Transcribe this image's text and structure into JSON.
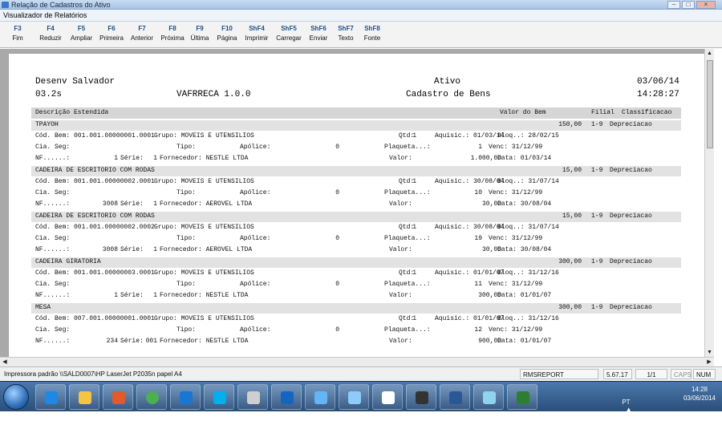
{
  "window": {
    "title": "Relação de Cadastros do Ativo",
    "subtitle": "Visualizador de Relatórios",
    "controls": [
      "–",
      "□",
      "×"
    ]
  },
  "toolbar": [
    {
      "key": "F3",
      "label": "Fim"
    },
    {
      "key": "F4",
      "label": "Reduzir"
    },
    {
      "key": "F5",
      "label": "Ampliar"
    },
    {
      "key": "F6",
      "label": "Primeira"
    },
    {
      "key": "F7",
      "label": "Anterior"
    },
    {
      "key": "F8",
      "label": "Próxima"
    },
    {
      "key": "F9",
      "label": "Última"
    },
    {
      "key": "F10",
      "label": "Página"
    },
    {
      "key": "ShF4",
      "label": "Imprimir"
    },
    {
      "key": "ShF5",
      "label": "Carregar"
    },
    {
      "key": "ShF6",
      "label": "Enviar"
    },
    {
      "key": "ShF7",
      "label": "Texto"
    },
    {
      "key": "ShF8",
      "label": "Fonte"
    }
  ],
  "report": {
    "header": {
      "company": "Desenv Salvador",
      "title": "Ativo",
      "date": "03/06/14",
      "version_code": "03.2s",
      "program": "VAFRRECA 1.0.0",
      "subtitle": "Cadastro de Bens",
      "time": "14:28:27"
    },
    "columns": {
      "description": "Descrição Estendida",
      "value": "Valor do Bem",
      "branch": "Filial",
      "classification": "Classificacao"
    },
    "items": [
      {
        "name": "TPAYOH",
        "value": "150,00",
        "branch": "1-9",
        "classification": "Depreciacao",
        "lines": [
          [
            "Cód. Bem: 001.001.00000001.0001",
            "Grupo: MOVEIS E UTENSILIOS",
            "Qtd:",
            "1",
            "Aquisic.: 01/03/14",
            "Bloq..: 28/02/15"
          ],
          [
            "Cia. Seg:",
            "Tipo:",
            "Apólice:",
            "0",
            "Plaqueta...:",
            "1",
            "Venc: 31/12/99"
          ],
          [
            "NF......:",
            "1",
            "Série:",
            "1",
            "Fornecedor: NESTLE LTDA",
            "Valor:",
            "1.000,00",
            "Data: 01/03/14"
          ]
        ]
      },
      {
        "name": "CADEIRA DE ESCRITORIO COM RODAS",
        "value": "15,00",
        "branch": "1-9",
        "classification": "Depreciacao",
        "lines": [
          [
            "Cód. Bem: 001.001.00000002.0001",
            "Grupo: MOVEIS E UTENSILIOS",
            "Qtd:",
            "1",
            "Aquisic.: 30/08/04",
            "Bloq..: 31/07/14"
          ],
          [
            "Cia. Seg:",
            "Tipo:",
            "Apólice:",
            "0",
            "Plaqueta...:",
            "10",
            "Venc: 31/12/99"
          ],
          [
            "NF......:",
            "3008",
            "Série:",
            "1",
            "Fornecedor: AEROVEL LTDA",
            "Valor:",
            "30,00",
            "Data: 30/08/04"
          ]
        ]
      },
      {
        "name": "CADEIRA DE ESCRITORIO COM RODAS",
        "value": "15,00",
        "branch": "1-9",
        "classification": "Depreciacao",
        "lines": [
          [
            "Cód. Bem: 001.001.00000002.0002",
            "Grupo: MOVEIS E UTENSILIOS",
            "Qtd:",
            "1",
            "Aquisic.: 30/08/04",
            "Bloq..: 31/07/14"
          ],
          [
            "Cia. Seg:",
            "Tipo:",
            "Apólice:",
            "0",
            "Plaqueta...:",
            "19",
            "Venc: 31/12/99"
          ],
          [
            "NF......:",
            "3008",
            "Série:",
            "1",
            "Fornecedor: AEROVEL LTDA",
            "Valor:",
            "30,00",
            "Data: 30/08/04"
          ]
        ]
      },
      {
        "name": "CADEIRA GIRATORIA",
        "value": "300,00",
        "branch": "1-9",
        "classification": "Depreciacao",
        "lines": [
          [
            "Cód. Bem: 001.001.00000003.0001",
            "Grupo: MOVEIS E UTENSILIOS",
            "Qtd:",
            "1",
            "Aquisic.: 01/01/07",
            "Bloq..: 31/12/16"
          ],
          [
            "Cia. Seg:",
            "Tipo:",
            "Apólice:",
            "0",
            "Plaqueta...:",
            "11",
            "Venc: 31/12/99"
          ],
          [
            "NF......:",
            "1",
            "Série:",
            "1",
            "Fornecedor: NESTLE LTDA",
            "Valor:",
            "300,00",
            "Data: 01/01/07"
          ]
        ]
      },
      {
        "name": "MESA",
        "value": "300,00",
        "branch": "1-9",
        "classification": "Depreciacao",
        "lines": [
          [
            "Cód. Bem: 007.001.00000001.0001",
            "Grupo: MOVEIS E UTENSILIOS",
            "Qtd:",
            "1",
            "Aquisic.: 01/01/07",
            "Bloq..: 31/12/16"
          ],
          [
            "Cia. Seg:",
            "Tipo:",
            "Apólice:",
            "0",
            "Plaqueta...:",
            "12",
            "Venc: 31/12/99"
          ],
          [
            "NF......:",
            "234",
            "Série:",
            "001",
            "Fornecedor: NESTLE LTDA",
            "Valor:",
            "900,00",
            "Data: 01/01/07"
          ]
        ]
      }
    ]
  },
  "statusbar": {
    "printer": "Impressora padrão \\\\SALD0007\\HP LaserJet P2035n papel A4",
    "report_name": "RMSREPORT",
    "version": "5.67.17",
    "pages": "1/1",
    "caps": "CAPS",
    "num": "NUM"
  },
  "taskbar": {
    "apps": [
      "ie-icon",
      "explorer-icon",
      "media-icon",
      "chrome-icon",
      "lync-icon",
      "skype-icon",
      "teamviewer-icon",
      "outlook-icon",
      "messenger-icon",
      "notes-icon",
      "app-icon",
      "ultraedit-icon",
      "word-icon",
      "paint-icon",
      "project-icon"
    ],
    "language": "PT",
    "time": "14:28",
    "date": "03/06/2014"
  },
  "colors": {
    "title_gradient": "#a7c3e6",
    "taskbar": "#2a4e79",
    "viewer_background": "#a9a9a9",
    "column_header": "#d6d6d6",
    "item_bar": "#e2e2e2"
  }
}
